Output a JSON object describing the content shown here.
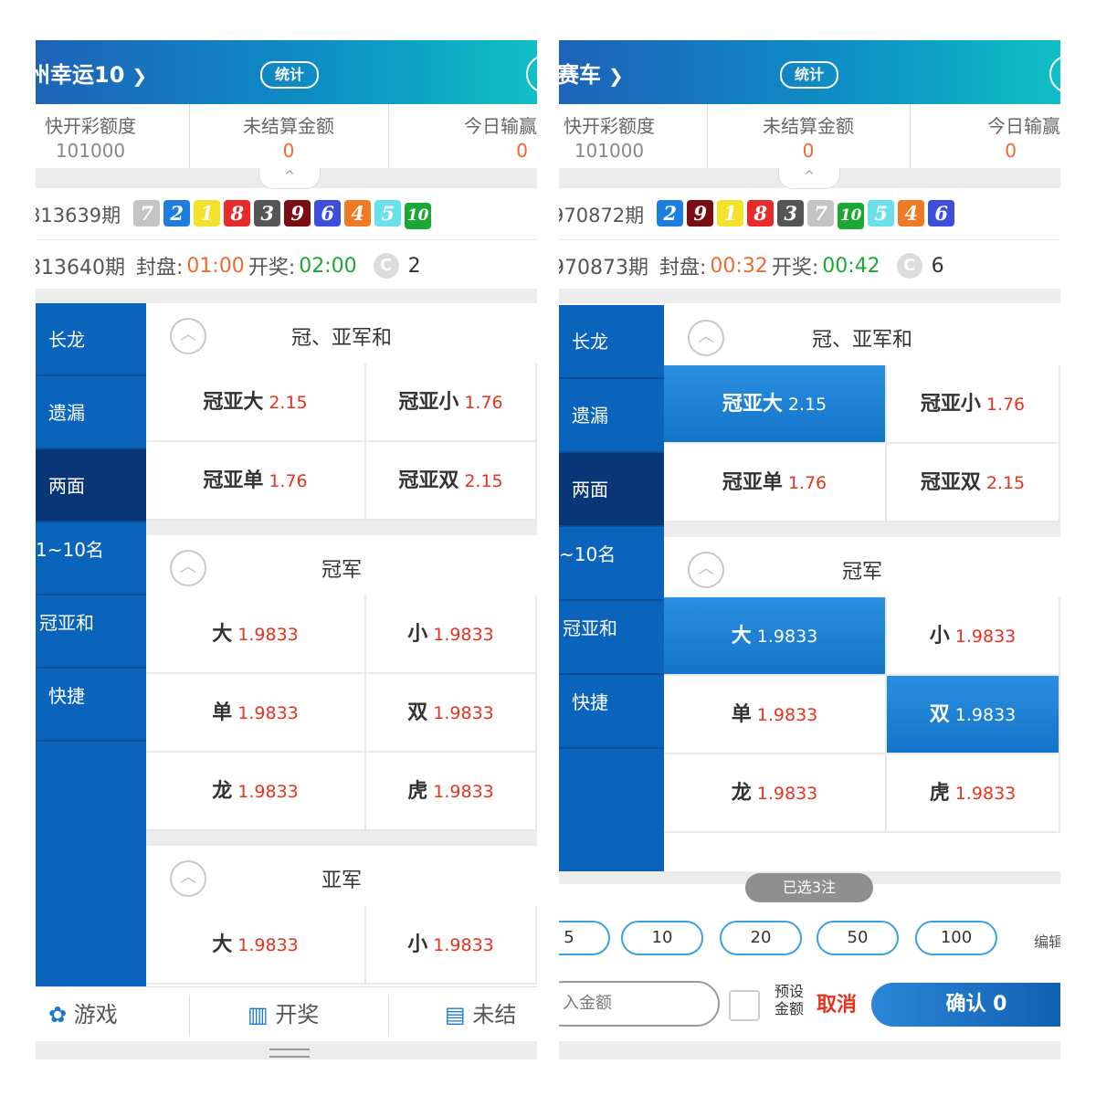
{
  "left": {
    "title": "州幸运10",
    "stat_label": "统计",
    "quota": {
      "a_label": "快开彩额度",
      "a_value": "101000",
      "b_label": "未结算金额",
      "b_value": "0",
      "c_label": "今日输赢",
      "c_value": "0"
    },
    "issue_prev": "813639期",
    "balls": [
      {
        "n": "7",
        "c": "#c4c4c4"
      },
      {
        "n": "2",
        "c": "#1e7ee0"
      },
      {
        "n": "1",
        "c": "#f2e22a"
      },
      {
        "n": "8",
        "c": "#e82a2a"
      },
      {
        "n": "3",
        "c": "#555555"
      },
      {
        "n": "9",
        "c": "#7a0e12"
      },
      {
        "n": "6",
        "c": "#3d4fd8"
      },
      {
        "n": "4",
        "c": "#f07a24"
      },
      {
        "n": "5",
        "c": "#6ae0ea"
      },
      {
        "n": "10",
        "c": "#1aa832"
      }
    ],
    "issue_next": "813640期",
    "close_label": "封盘:",
    "close_time": "01:00",
    "open_label": "开奖:",
    "open_time": "02:00",
    "refresh_count": "2",
    "sidebar": [
      "长龙",
      "遗漏",
      "两面",
      "1~10名",
      "冠亚和",
      "快捷"
    ],
    "sections": [
      {
        "title": "冠、亚军和",
        "cells": [
          {
            "l": "冠亚大",
            "o": "2.15"
          },
          {
            "l": "冠亚小",
            "o": "1.76"
          },
          {
            "l": "冠亚单",
            "o": "1.76"
          },
          {
            "l": "冠亚双",
            "o": "2.15"
          }
        ]
      },
      {
        "title": "冠军",
        "cells": [
          {
            "l": "大",
            "o": "1.9833"
          },
          {
            "l": "小",
            "o": "1.9833"
          },
          {
            "l": "单",
            "o": "1.9833"
          },
          {
            "l": "双",
            "o": "1.9833"
          },
          {
            "l": "龙",
            "o": "1.9833"
          },
          {
            "l": "虎",
            "o": "1.9833"
          }
        ]
      },
      {
        "title": "亚军",
        "cells": [
          {
            "l": "大",
            "o": "1.9833"
          },
          {
            "l": "小",
            "o": "1.9833"
          }
        ]
      }
    ],
    "tabs": [
      "游戏",
      "开奖",
      "未结"
    ]
  },
  "right": {
    "title": "赛车",
    "stat_label": "统计",
    "quota": {
      "a_label": "快开彩额度",
      "a_value": "101000",
      "b_label": "未结算金额",
      "b_value": "0",
      "c_label": "今日输赢",
      "c_value": "0"
    },
    "issue_prev": "970872期",
    "balls": [
      {
        "n": "2",
        "c": "#1e7ee0"
      },
      {
        "n": "9",
        "c": "#7a0e12"
      },
      {
        "n": "1",
        "c": "#f2e22a"
      },
      {
        "n": "8",
        "c": "#e82a2a"
      },
      {
        "n": "3",
        "c": "#555555"
      },
      {
        "n": "7",
        "c": "#c4c4c4"
      },
      {
        "n": "10",
        "c": "#1aa832"
      },
      {
        "n": "5",
        "c": "#6ae0ea"
      },
      {
        "n": "4",
        "c": "#f07a24"
      },
      {
        "n": "6",
        "c": "#3d4fd8"
      }
    ],
    "issue_next": "970873期",
    "close_label": "封盘:",
    "close_time": "00:32",
    "open_label": "开奖:",
    "open_time": "00:42",
    "refresh_count": "6",
    "sidebar": [
      "长龙",
      "遗漏",
      "两面",
      "~10名",
      "冠亚和",
      "快捷"
    ],
    "sections": [
      {
        "title": "冠、亚军和",
        "cells": [
          {
            "l": "冠亚大",
            "o": "2.15",
            "sel": true
          },
          {
            "l": "冠亚小",
            "o": "1.76"
          },
          {
            "l": "冠亚单",
            "o": "1.76"
          },
          {
            "l": "冠亚双",
            "o": "2.15"
          }
        ]
      },
      {
        "title": "冠军",
        "cells": [
          {
            "l": "大",
            "o": "1.9833",
            "sel": true
          },
          {
            "l": "小",
            "o": "1.9833"
          },
          {
            "l": "单",
            "o": "1.9833"
          },
          {
            "l": "双",
            "o": "1.9833",
            "sel": true
          },
          {
            "l": "龙",
            "o": "1.9833"
          },
          {
            "l": "虎",
            "o": "1.9833"
          }
        ]
      }
    ],
    "selected_count": "已选3注",
    "chips": [
      "5",
      "10",
      "20",
      "50",
      "100"
    ],
    "edit_label": "编辑",
    "amount_placeholder": "入金额",
    "preset_label": "预设金额",
    "cancel_label": "取消",
    "confirm_label": "确认 0"
  }
}
